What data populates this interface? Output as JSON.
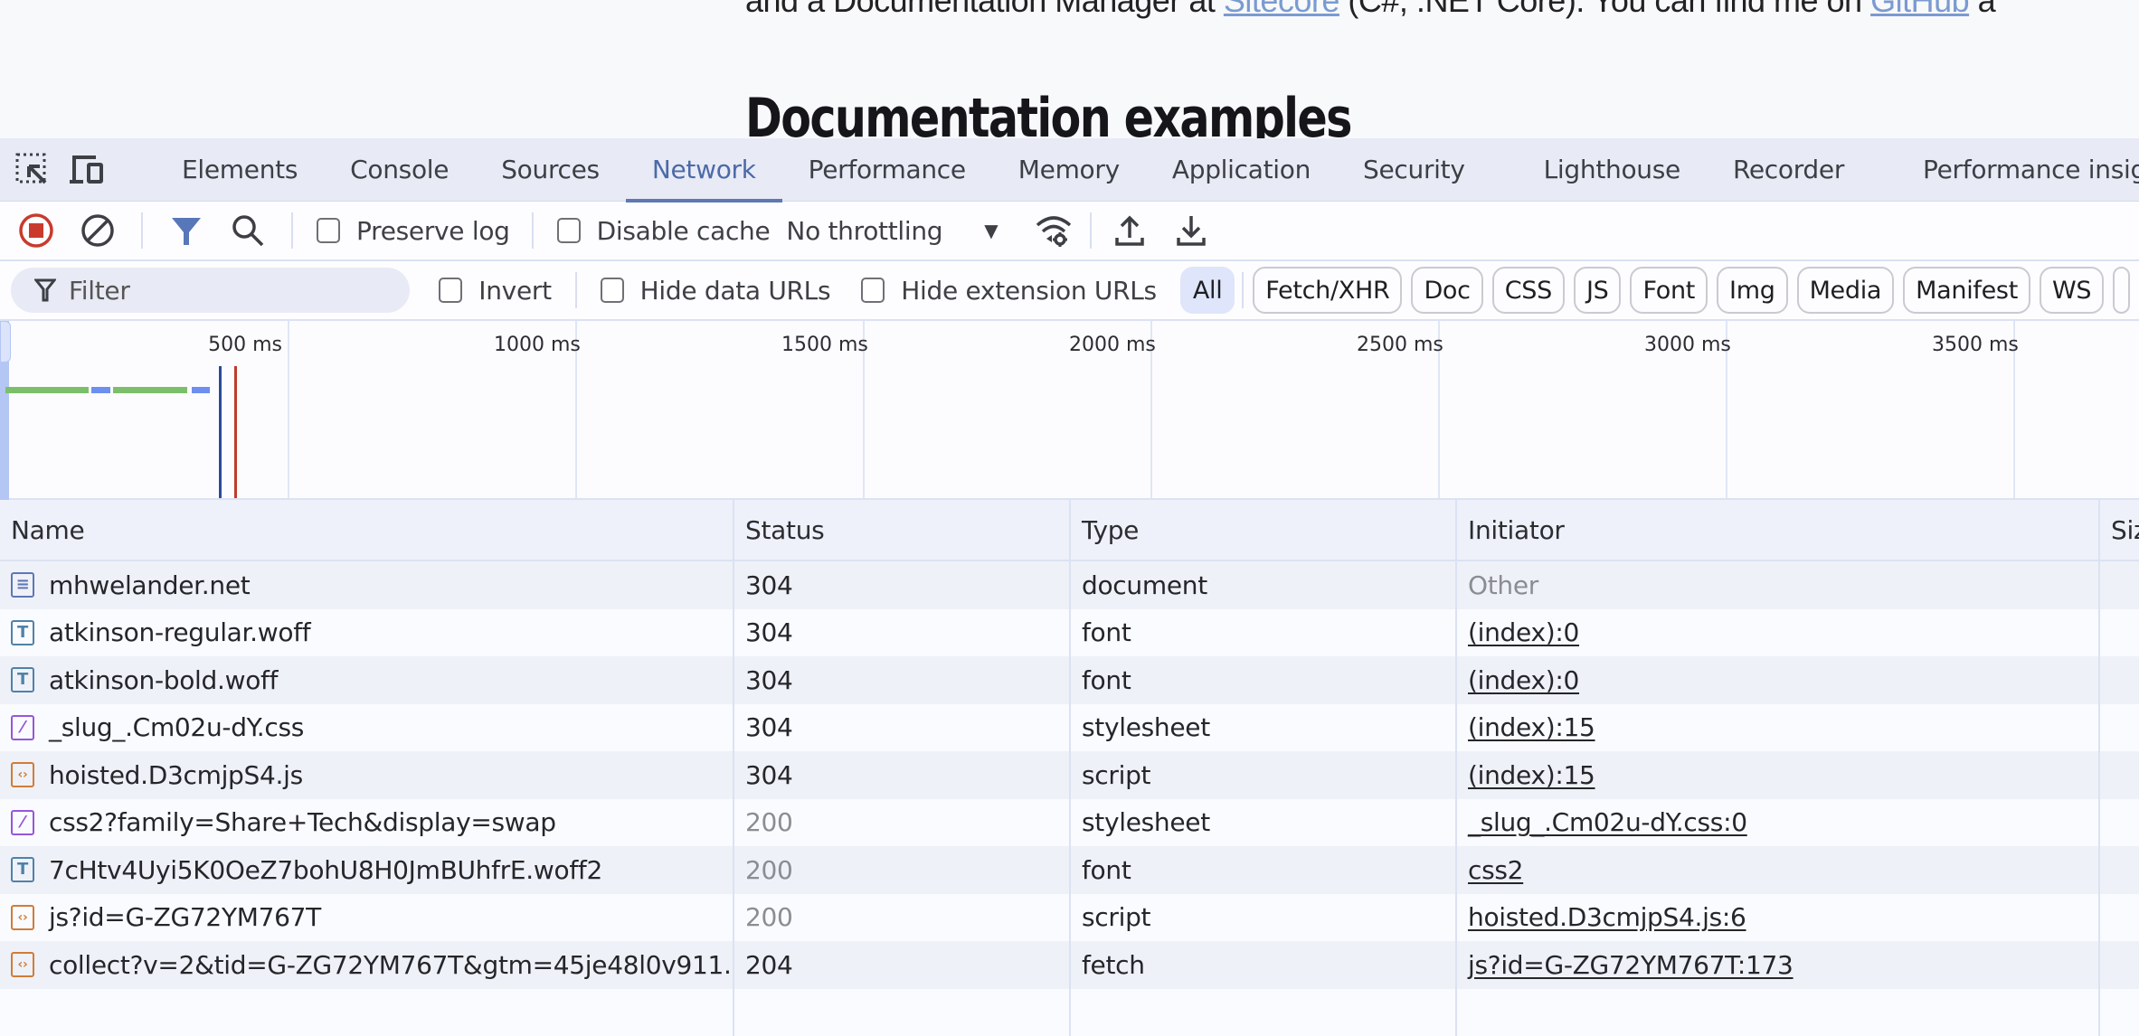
{
  "page": {
    "text_before_link1": "and a Documentation Manager at ",
    "link1": "Sitecore",
    "text_between": " (C#, .NET Core). You can find me on ",
    "link2": "GitHub",
    "text_after": " a",
    "heading": "Documentation examples"
  },
  "devtools": {
    "tabs": [
      {
        "label": "Elements"
      },
      {
        "label": "Console"
      },
      {
        "label": "Sources"
      },
      {
        "label": "Network",
        "active": true
      },
      {
        "label": "Performance"
      },
      {
        "label": "Memory"
      },
      {
        "label": "Application"
      },
      {
        "label": "Security"
      },
      {
        "label": "Lighthouse"
      },
      {
        "label": "Recorder"
      },
      {
        "label": "Performance insights"
      }
    ],
    "toolbar": {
      "preserve_log": "Preserve log",
      "disable_cache": "Disable cache",
      "throttling": "No throttling"
    },
    "filterbar": {
      "filter_placeholder": "Filter",
      "invert": "Invert",
      "hide_data_urls": "Hide data URLs",
      "hide_extension_urls": "Hide extension URLs",
      "types": [
        "All",
        "Fetch/XHR",
        "Doc",
        "CSS",
        "JS",
        "Font",
        "Img",
        "Media",
        "Manifest",
        "WS"
      ]
    },
    "overview": {
      "ticks": [
        "500 ms",
        "1000 ms",
        "1500 ms",
        "2000 ms",
        "2500 ms",
        "3000 ms",
        "3500 ms"
      ],
      "dom_content_loaded_ms": 380,
      "load_ms": 408,
      "colors": {
        "waiting": "#7cbf6b",
        "download": "#6d8ff0",
        "dcl": "#2c4a9c",
        "load": "#c0392b"
      }
    },
    "table": {
      "headers": {
        "name": "Name",
        "status": "Status",
        "type": "Type",
        "initiator": "Initiator",
        "size": "Siz"
      },
      "rows": [
        {
          "name": "mhwelander.net",
          "icon": "document",
          "status": "304",
          "type": "document",
          "initiator": "Other",
          "initiator_link": false
        },
        {
          "name": "atkinson-regular.woff",
          "icon": "font",
          "status": "304",
          "type": "font",
          "initiator": "(index):0",
          "initiator_link": true
        },
        {
          "name": "atkinson-bold.woff",
          "icon": "font",
          "status": "304",
          "type": "font",
          "initiator": "(index):0",
          "initiator_link": true
        },
        {
          "name": "_slug_.Cm02u-dY.css",
          "icon": "stylesheet",
          "status": "304",
          "type": "stylesheet",
          "initiator": "(index):15",
          "initiator_link": true
        },
        {
          "name": "hoisted.D3cmjpS4.js",
          "icon": "script",
          "status": "304",
          "type": "script",
          "initiator": "(index):15",
          "initiator_link": true
        },
        {
          "name": "css2?family=Share+Tech&display=swap",
          "icon": "stylesheet",
          "status": "200",
          "type": "stylesheet",
          "initiator": "_slug_.Cm02u-dY.css:0",
          "initiator_link": true
        },
        {
          "name": "7cHtv4Uyi5K0OeZ7bohU8H0JmBUhfrE.woff2",
          "icon": "font",
          "status": "200",
          "type": "font",
          "initiator": "css2",
          "initiator_link": true
        },
        {
          "name": "js?id=G-ZG72YM767T",
          "icon": "script",
          "status": "200",
          "type": "script",
          "initiator": "hoisted.D3cmjpS4.js:6",
          "initiator_link": true
        },
        {
          "name": "collect?v=2&tid=G-ZG72YM767T&gtm=45je48l0v911...",
          "icon": "script",
          "status": "204",
          "type": "fetch",
          "initiator": "js?id=G-ZG72YM767T:173",
          "initiator_link": true
        }
      ]
    }
  }
}
